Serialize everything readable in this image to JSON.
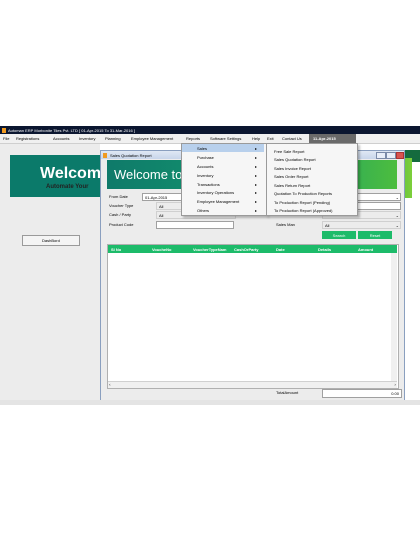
{
  "titlebar": {
    "text": "Automan ERP Morbonite Tiles Pvt. LTD [ 01-Apr-2015 To 31-Mar-2016 ]"
  },
  "menubar": {
    "items": [
      "File",
      "Registrations",
      "Accounts",
      "Inventory",
      "Planning",
      "Employee Management",
      "Reports",
      "Software Settings",
      "Help",
      "Exit",
      "Contact Us"
    ],
    "date": "11-Apr-2015"
  },
  "left": {
    "banner_big": "Welcom",
    "banner_small": "Automate Your",
    "dash_button": "DashBord"
  },
  "window": {
    "title": "Sales Quotation Report",
    "banner": "Welcome to Au",
    "form": {
      "from_date_label": "From Date",
      "from_date_value": "01-Apr-2015",
      "voucher_type_label": "Voucher Type",
      "voucher_type_value": "All",
      "cash_party_label": "Cash / Party",
      "cash_party_value": "All",
      "product_code_label": "Product Code",
      "sales_man_label": "Sales Man",
      "sales_man_value": "All",
      "stock_label": "Stock",
      "search_label": "Search",
      "reset_label": "Reset"
    },
    "grid": {
      "columns": [
        "Sl No",
        "VoucheNo",
        "VoucherTypeNam",
        "CashOrParty",
        "Date",
        "Details",
        "Amount"
      ]
    },
    "total_label": "TotalAmount",
    "total_value": "0.00"
  },
  "reports_menu": {
    "items": [
      "Sales",
      "Purchase",
      "Accounts",
      "Inventory",
      "Transactions",
      "Inventory Operations",
      "Employee Management",
      "Others"
    ]
  },
  "sales_submenu": {
    "items": [
      "Free Sale Report",
      "Sales Quotation Report",
      "Sales Invoice Report",
      "Sales Order Report",
      "Sales Return Report",
      "Quotation To Production Reports",
      "To Production Report (Pending)",
      "To Production Report (Approved)"
    ]
  }
}
